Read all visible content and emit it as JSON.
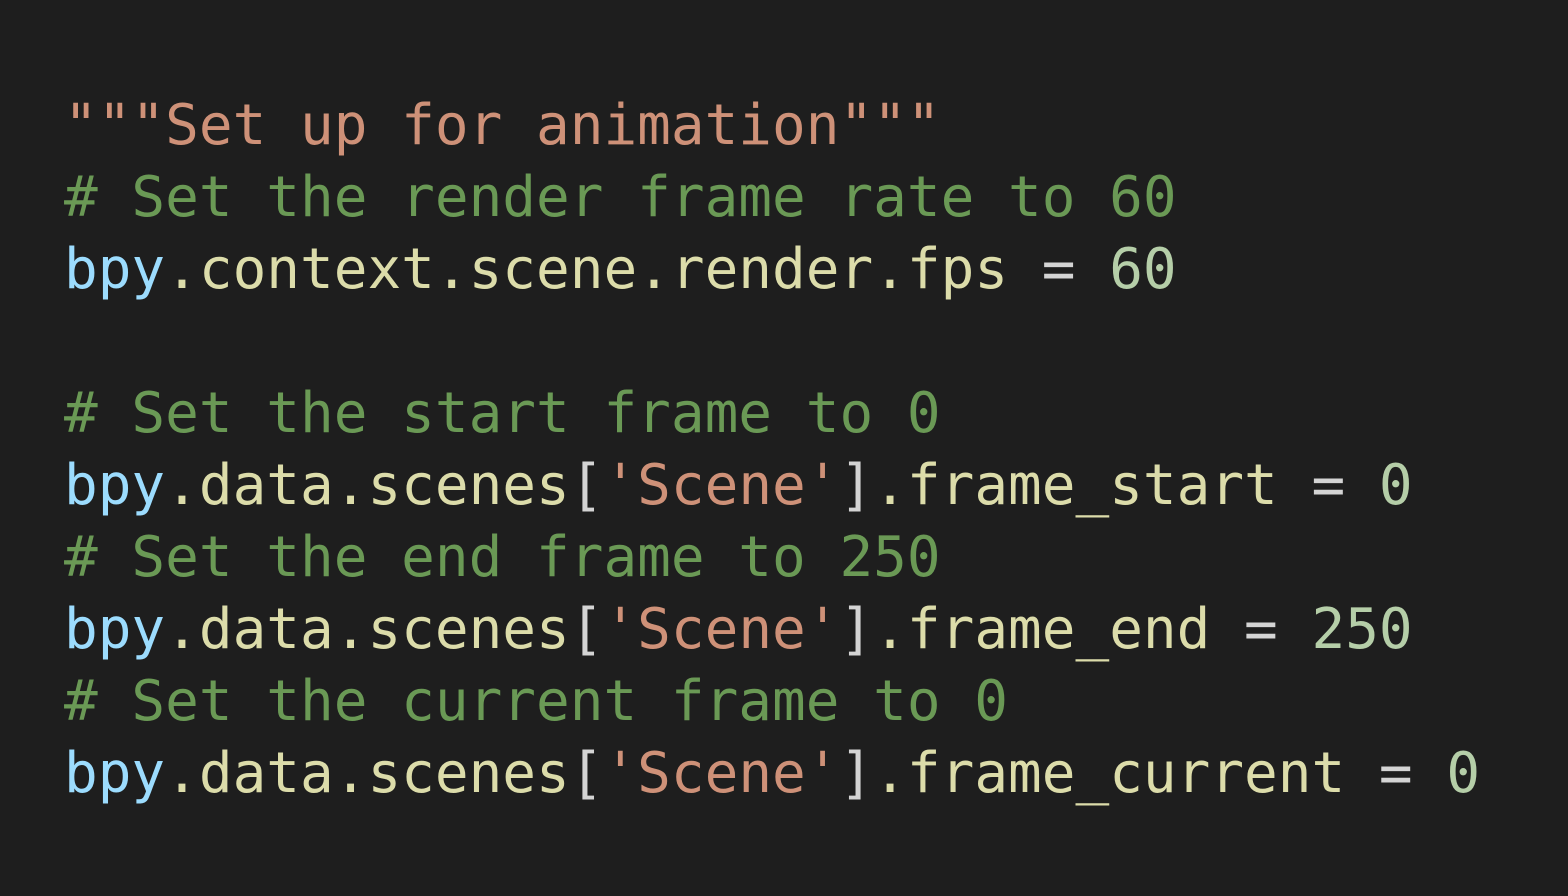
{
  "colors": {
    "background": "#1e1e1e",
    "string": "#ce9178",
    "comment": "#6a9955",
    "variable": "#9cdcfe",
    "property": "#dcdcaa",
    "punctuation": "#d4d4d4",
    "number": "#b5cea8"
  },
  "code": {
    "lines": [
      [
        {
          "t": "\"\"\"Set up for animation\"\"\"",
          "k": "string"
        }
      ],
      [
        {
          "t": "# Set the render frame rate to 60",
          "k": "comment"
        }
      ],
      [
        {
          "t": "bpy",
          "k": "var"
        },
        {
          "t": ".context.scene.render.fps",
          "k": "prop"
        },
        {
          "t": " = ",
          "k": "punct"
        },
        {
          "t": "60",
          "k": "num"
        }
      ],
      [],
      [
        {
          "t": "# Set the start frame to 0",
          "k": "comment"
        }
      ],
      [
        {
          "t": "bpy",
          "k": "var"
        },
        {
          "t": ".data.scenes",
          "k": "prop"
        },
        {
          "t": "[",
          "k": "punct"
        },
        {
          "t": "'Scene'",
          "k": "string"
        },
        {
          "t": "]",
          "k": "punct"
        },
        {
          "t": ".frame_start",
          "k": "prop"
        },
        {
          "t": " = ",
          "k": "punct"
        },
        {
          "t": "0",
          "k": "num"
        }
      ],
      [
        {
          "t": "# Set the end frame to 250",
          "k": "comment"
        }
      ],
      [
        {
          "t": "bpy",
          "k": "var"
        },
        {
          "t": ".data.scenes",
          "k": "prop"
        },
        {
          "t": "[",
          "k": "punct"
        },
        {
          "t": "'Scene'",
          "k": "string"
        },
        {
          "t": "]",
          "k": "punct"
        },
        {
          "t": ".frame_end",
          "k": "prop"
        },
        {
          "t": " = ",
          "k": "punct"
        },
        {
          "t": "250",
          "k": "num"
        }
      ],
      [
        {
          "t": "# Set the current frame to 0",
          "k": "comment"
        }
      ],
      [
        {
          "t": "bpy",
          "k": "var"
        },
        {
          "t": ".data.scenes",
          "k": "prop"
        },
        {
          "t": "[",
          "k": "punct"
        },
        {
          "t": "'Scene'",
          "k": "string"
        },
        {
          "t": "]",
          "k": "punct"
        },
        {
          "t": ".frame_current",
          "k": "prop"
        },
        {
          "t": " = ",
          "k": "punct"
        },
        {
          "t": "0",
          "k": "num"
        }
      ]
    ]
  }
}
